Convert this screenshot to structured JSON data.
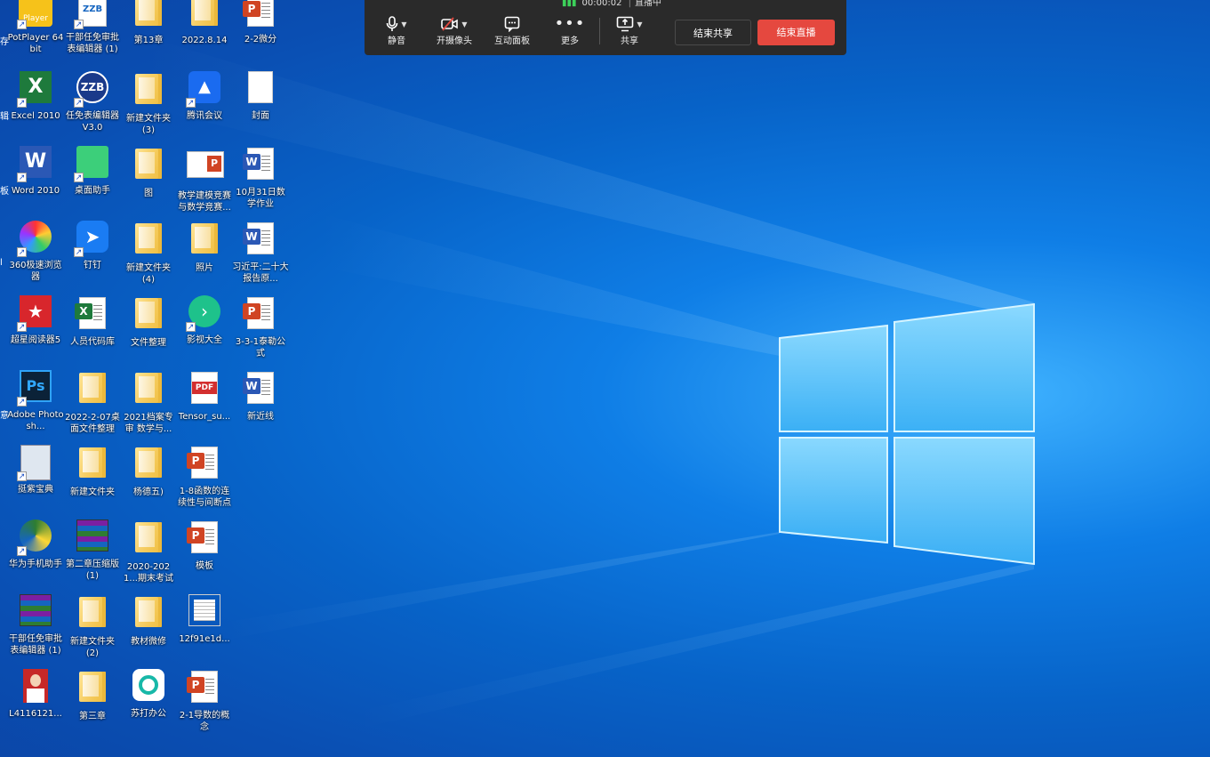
{
  "meeting_bar": {
    "timer": "00:00:02",
    "live_status": "直播中",
    "buttons": [
      {
        "label": "静音",
        "icon": "microphone-icon"
      },
      {
        "label": "开摄像头",
        "icon": "camera-off-icon"
      },
      {
        "label": "互动面板",
        "icon": "chat-panel-icon"
      },
      {
        "label": "更多",
        "icon": "more-dots-icon"
      },
      {
        "label": "共享",
        "icon": "screen-share-icon"
      }
    ],
    "end_share_label": "结束共享",
    "end_live_label": "结束直播",
    "end_live_color": "#e5483f"
  },
  "edge_labels": [
    "存",
    "辑",
    "板",
    "l",
    "",
    "意"
  ],
  "desktop_icons": {
    "col1": [
      {
        "label": "PotPlayer 64 bit",
        "icon": "potplayer-icon"
      },
      {
        "label": "Excel 2010",
        "icon": "excel-icon"
      },
      {
        "label": "Word 2010",
        "icon": "word-icon"
      },
      {
        "label": "360极速浏览器",
        "icon": "browser-360-icon"
      },
      {
        "label": "超星阅读器5",
        "icon": "superstar-reader-icon"
      },
      {
        "label": "Adobe Photosh...",
        "icon": "photoshop-icon"
      },
      {
        "label": "挺紫宝典",
        "icon": "notebook-icon"
      },
      {
        "label": "华为手机助手",
        "icon": "huawei-assistant-icon"
      },
      {
        "label": "干部任免审批表编辑器 (1)",
        "icon": "winrar-icon"
      },
      {
        "label": "L4116121...",
        "icon": "photo-portrait-icon"
      }
    ],
    "col2": [
      {
        "label": "干部任免审批表编辑器 (1)",
        "icon": "app-icon"
      },
      {
        "label": "任免表编辑器V3.0",
        "icon": "zzb-icon"
      },
      {
        "label": "桌面助手",
        "icon": "desktop-assistant-icon"
      },
      {
        "label": "钉钉",
        "icon": "dingtalk-icon"
      },
      {
        "label": "人员代码库",
        "icon": "excel-file-icon"
      },
      {
        "label": "2022-2-07桌面文件整理",
        "icon": "folder-icon"
      },
      {
        "label": "新建文件夹",
        "icon": "folder-icon"
      },
      {
        "label": "第二章压缩版 (1)",
        "icon": "winrar-icon"
      },
      {
        "label": "新建文件夹 (2)",
        "icon": "folder-icon"
      },
      {
        "label": "第三章",
        "icon": "folder-icon"
      }
    ],
    "col3": [
      {
        "label": "第13章",
        "icon": "folder-icon"
      },
      {
        "label": "新建文件夹 (3)",
        "icon": "folder-icon"
      },
      {
        "label": "图",
        "icon": "folder-icon"
      },
      {
        "label": "新建文件夹 (4)",
        "icon": "folder-icon"
      },
      {
        "label": "文件整理",
        "icon": "folder-icon"
      },
      {
        "label": "2021档案专审 数学与...",
        "icon": "folder-icon"
      },
      {
        "label": "杨德五)",
        "icon": "folder-icon"
      },
      {
        "label": "2020-2021...期末考试",
        "icon": "folder-icon"
      },
      {
        "label": "教材微修",
        "icon": "folder-icon"
      },
      {
        "label": "苏打办公",
        "icon": "sudaoffice-icon"
      }
    ],
    "col4": [
      {
        "label": "2022.8.14",
        "icon": "folder-icon"
      },
      {
        "label": "腾讯会议",
        "icon": "tencent-meeting-icon"
      },
      {
        "label": "教学建模竞赛与数学竞赛...",
        "icon": "ppt-icon"
      },
      {
        "label": "照片",
        "icon": "folder-icon"
      },
      {
        "label": "影视大全",
        "icon": "video-app-icon"
      },
      {
        "label": "Tensor_su...",
        "icon": "pdf-icon"
      },
      {
        "label": "1-8函数的连续性与间断点",
        "icon": "ppt-icon"
      },
      {
        "label": "模板",
        "icon": "ppt-icon"
      },
      {
        "label": "12f91e1d...",
        "icon": "text-file-icon"
      },
      {
        "label": "2-1导数的概念",
        "icon": "ppt-icon"
      }
    ],
    "col5": [
      {
        "label": "2-2微分",
        "icon": "ppt-icon"
      },
      {
        "label": "封面",
        "icon": "doc-file-icon"
      },
      {
        "label": "10月31日数学作业",
        "icon": "word-doc-icon"
      },
      {
        "label": "习近平:二十大报告原...",
        "icon": "word-doc-icon"
      },
      {
        "label": "3-3-1泰勒公式",
        "icon": "ppt-icon"
      },
      {
        "label": "新近线",
        "icon": "word-doc-icon"
      }
    ]
  }
}
